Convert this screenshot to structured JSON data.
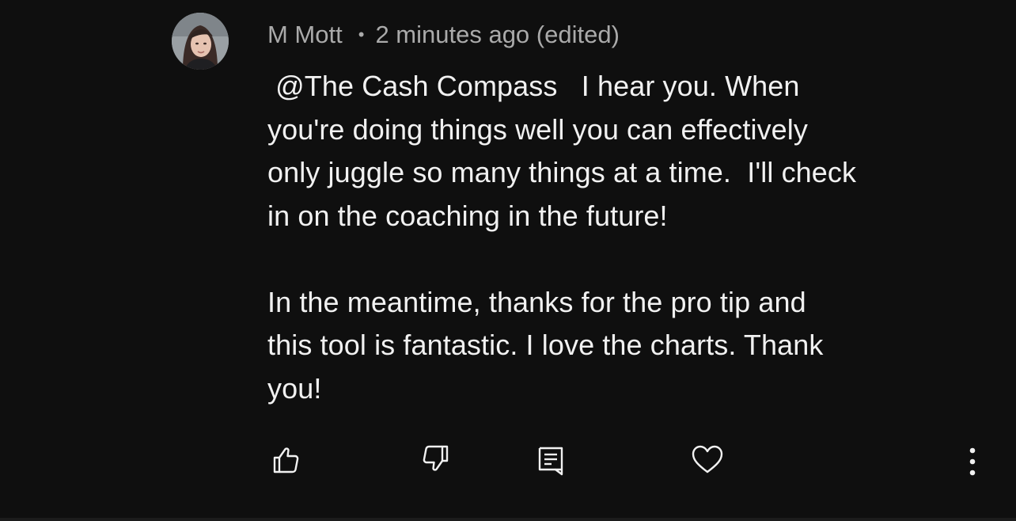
{
  "comment": {
    "author": "M Mott",
    "separator": "•",
    "timestamp": "2 minutes ago (edited)",
    "mention": "@The Cash Compass",
    "paragraph1_lines": [
      "   I hear you. When",
      "you're doing things well you can effectively",
      "only juggle so many things at a time.  I'll check",
      "in on the coaching in the future!"
    ],
    "paragraph2_lines": [
      "In the meantime, thanks for the pro tip and",
      "this tool is fantastic. I love the charts. Thank",
      "you!"
    ]
  },
  "actions": {
    "like_icon": "thumbs-up-icon",
    "dislike_icon": "thumbs-down-icon",
    "reply_icon": "reply-comment-icon",
    "heart_icon": "heart-icon",
    "more_icon": "more-vertical-icon"
  },
  "colors": {
    "background": "#0f0f0f",
    "primary_text": "#f1f1f1",
    "secondary_text": "#aaaaaa"
  }
}
